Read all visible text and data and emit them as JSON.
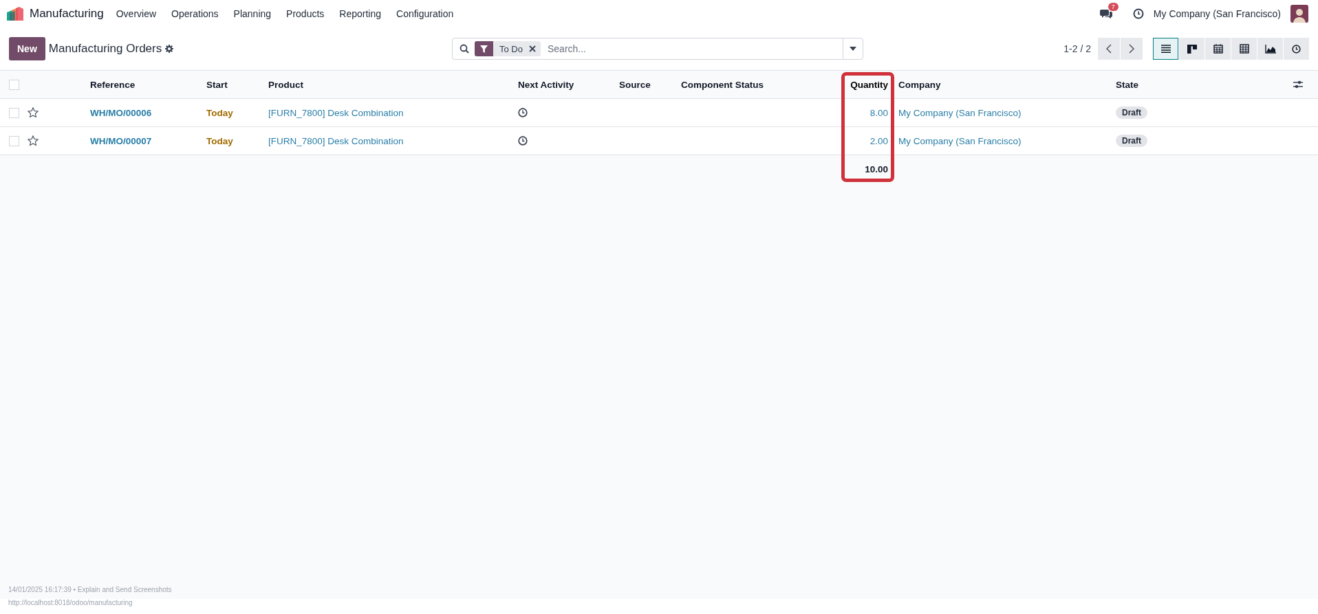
{
  "app": {
    "name": "Manufacturing"
  },
  "menu": [
    {
      "label": "Overview"
    },
    {
      "label": "Operations"
    },
    {
      "label": "Planning"
    },
    {
      "label": "Products"
    },
    {
      "label": "Reporting"
    },
    {
      "label": "Configuration"
    }
  ],
  "systray": {
    "messages_count": "7",
    "company": "My Company (San Francisco)"
  },
  "control_panel": {
    "new_button": "New",
    "title": "Manufacturing Orders",
    "search": {
      "facets": [
        {
          "label": "To Do"
        }
      ],
      "placeholder": "Search..."
    },
    "pager": "1-2 / 2",
    "views": [
      {
        "kind": "list",
        "selected": true
      },
      {
        "kind": "kanban",
        "selected": false
      },
      {
        "kind": "calendar",
        "selected": false
      },
      {
        "kind": "pivot",
        "selected": false
      },
      {
        "kind": "graph",
        "selected": false
      },
      {
        "kind": "activity",
        "selected": false
      }
    ]
  },
  "table": {
    "all_selected": false,
    "columns": [
      {
        "label": "Reference",
        "highlighted": false
      },
      {
        "label": "Start",
        "highlighted": false
      },
      {
        "label": "Product",
        "highlighted": false
      },
      {
        "label": "Next Activity",
        "highlighted": false
      },
      {
        "label": "Source",
        "highlighted": false
      },
      {
        "label": "Component Status",
        "highlighted": false
      },
      {
        "label": "Quantity",
        "highlighted": true
      },
      {
        "label": "Company",
        "highlighted": false
      },
      {
        "label": "State",
        "highlighted": false
      }
    ],
    "rows": [
      {
        "selected": false,
        "starred": false,
        "reference": "WH/MO/00006",
        "start": "Today",
        "product": "[FURN_7800] Desk Combination",
        "quantity": "8.00",
        "company": "My Company (San Francisco)",
        "state": "Draft"
      },
      {
        "selected": false,
        "starred": false,
        "reference": "WH/MO/00007",
        "start": "Today",
        "product": "[FURN_7800] Desk Combination",
        "quantity": "2.00",
        "company": "My Company (San Francisco)",
        "state": "Draft"
      }
    ],
    "totals": {
      "quantity": "10.00"
    }
  },
  "caption": {
    "line_1": "14/01/2025 16:17:39 • Explain and Send Screenshots",
    "line_2": "http://localhost:8018/odoo/manufacturing"
  }
}
